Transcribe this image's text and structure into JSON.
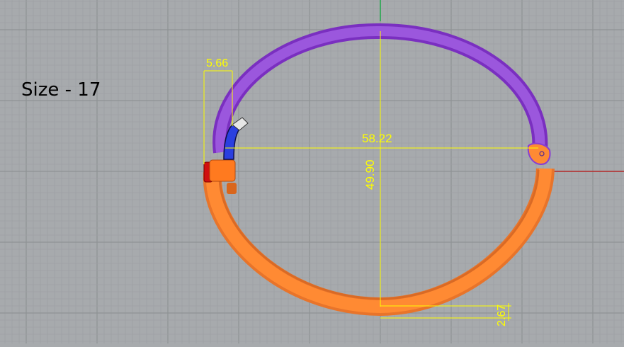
{
  "view": {
    "size_label": "Size - 17",
    "colors": {
      "background": "#a7aaad",
      "grid_minor": "#9ea1a4",
      "grid_major": "#8f9295",
      "y_axis": "#1fa84a",
      "x_axis": "#b52a2a",
      "dimension": "#ffff00",
      "upper_band": "#8a3fd0",
      "lower_band": "#ff7a1f",
      "clasp_red": "#d01010",
      "stone_blue": "#2233cc"
    }
  },
  "dimensions": {
    "width": "58.22",
    "height": "49.90",
    "clasp_width": "5.66",
    "band_thickness": "2.67"
  }
}
